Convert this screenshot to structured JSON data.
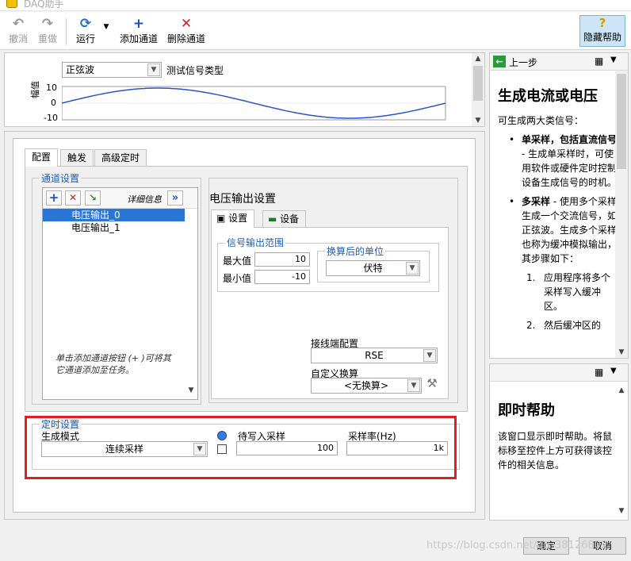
{
  "window": {
    "title": "DAQ助手"
  },
  "toolbar": {
    "undo": "撤消",
    "redo": "重做",
    "run": "运行",
    "add_channel": "添加通道",
    "remove_channel": "删除通道",
    "hidden_help": "隐藏帮助"
  },
  "signal": {
    "type_value": "正弦波",
    "type_label": "测试信号类型",
    "ylabel": "幅值",
    "yticks": [
      "10",
      "0",
      "-10"
    ]
  },
  "chart_data": {
    "type": "line",
    "ylabel": "幅值",
    "ylim": [
      -10,
      10
    ],
    "series": [
      {
        "x": [
          0,
          0.125,
          0.25,
          0.375,
          0.5,
          0.625,
          0.75,
          0.875,
          1
        ],
        "values": [
          0,
          7.07,
          10,
          7.07,
          0,
          -7.07,
          -10,
          -7.07,
          0
        ]
      }
    ]
  },
  "tabs": [
    "配置",
    "触发",
    "高级定时"
  ],
  "channels": {
    "group_title": "通道设置",
    "detail_label": "详细信息",
    "items": [
      "电压输出_0",
      "电压输出_1"
    ],
    "hint": "单击添加通道按钮 (+ )可将其它通道添加至任务。"
  },
  "voltage": {
    "title": "电压输出设置",
    "subtabs": [
      "设置",
      "设备"
    ],
    "range_title": "信号输出范围",
    "max_label": "最大值",
    "max_value": "10",
    "min_label": "最小值",
    "min_value": "-10",
    "unit_title": "换算后的单位",
    "unit_value": "伏特",
    "terminal_label": "接线端配置",
    "terminal_value": "RSE",
    "scale_label": "自定义换算",
    "scale_value": "<无换算>"
  },
  "timing": {
    "title": "定时设置",
    "mode_label": "生成模式",
    "mode_value": "连续采样",
    "samples_label": "待写入采样",
    "samples_value": "100",
    "rate_label": "采样率(Hz)",
    "rate_value": "1k"
  },
  "help_top": {
    "back": "上一步",
    "heading": "生成电流或电压",
    "intro": "可生成两大类信号：",
    "bullet1_bold": "单采样，包括直流信号",
    "bullet1_rest": " - 生成单采样时，可使用软件或硬件定时控制设备生成信号的时机。",
    "bullet2_bold": "多采样",
    "bullet2_rest": " - 使用多个采样生成一个交流信号，如正弦波。生成多个采样也称为缓冲模拟输出，其步骤如下：",
    "step1": "应用程序将多个采样写入缓冲区。",
    "step2": "然后缓冲区的"
  },
  "help_bottom": {
    "heading": "即时帮助",
    "text": "该窗口显示即时帮助。将鼠标移至控件上方可获得该控件的相关信息。"
  },
  "buttons": {
    "ok": "确定",
    "cancel": "取消"
  },
  "watermark": "https://blog.csdn.net/qq_38126802"
}
